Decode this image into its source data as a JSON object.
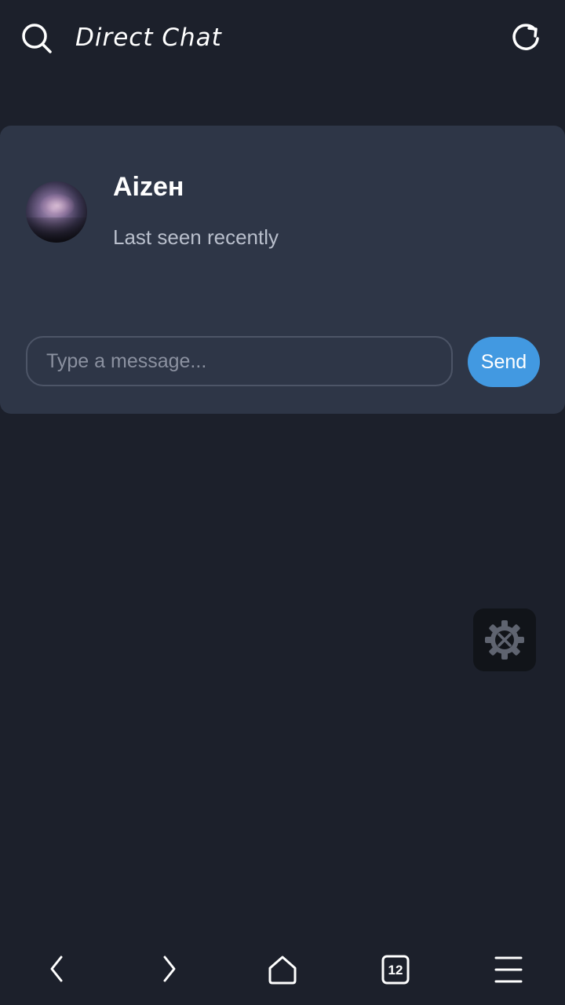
{
  "header": {
    "title": "Direct Chat",
    "search_icon": "search-icon",
    "refresh_icon": "refresh-icon"
  },
  "chat": {
    "contact_name": "Aizeн",
    "status": "Last seen recently",
    "input_placeholder": "Type a message...",
    "send_label": "Send"
  },
  "floating_button": {
    "icon": "gear-tools-icon"
  },
  "browser_nav": {
    "tab_count": "12",
    "items": [
      "back-icon",
      "forward-icon",
      "home-icon",
      "tabs-icon",
      "menu-icon"
    ]
  },
  "colors": {
    "background": "#1c202b",
    "card": "#2e3647",
    "accent": "#4299e1",
    "muted_text": "#b9bfcc"
  }
}
